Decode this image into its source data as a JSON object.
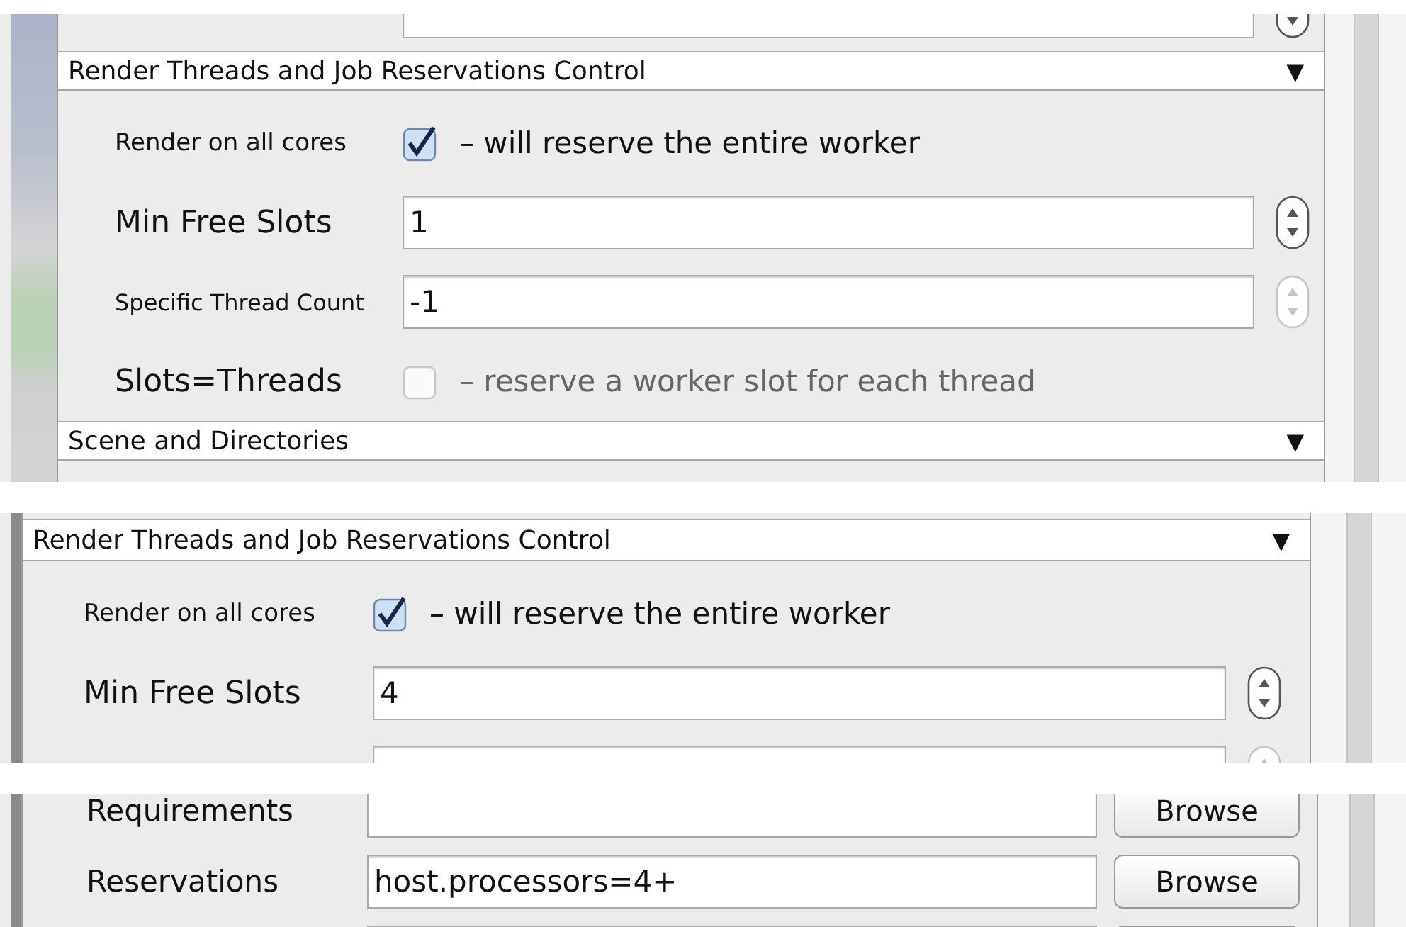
{
  "panels": [
    {
      "items": [
        {
          "kind": "spinner",
          "disabled": false
        },
        {
          "kind": "header",
          "title": "Render Threads and Job Reservations Control",
          "toggle": "▼"
        },
        {
          "kind": "checkbox",
          "label": "Render on all cores",
          "checked": true,
          "disabled": false,
          "note": "– will reserve the entire worker"
        },
        {
          "kind": "spinner",
          "label": "Min Free Slots",
          "value": "1",
          "disabled": false
        },
        {
          "kind": "spinner",
          "label": "Specific Thread Count",
          "value": "-1",
          "disabled": true
        },
        {
          "kind": "checkbox",
          "label": "Slots=Threads",
          "checked": false,
          "disabled": true,
          "note": "– reserve a worker slot for each thread"
        },
        {
          "kind": "header",
          "title": "Scene and Directories",
          "toggle": "▼"
        }
      ]
    },
    {
      "items": [
        {
          "kind": "header",
          "title": "Render Threads and Job Reservations Control",
          "toggle": "▼"
        },
        {
          "kind": "checkbox",
          "label": "Render on all cores",
          "checked": true,
          "disabled": false,
          "note": "– will reserve the entire worker"
        },
        {
          "kind": "spinner",
          "label": "Min Free Slots",
          "value": "4",
          "disabled": false
        },
        {
          "kind": "spinner",
          "disabled": true
        }
      ]
    },
    {
      "items": [
        {
          "kind": "field",
          "label": "Requirements",
          "button": "Browse"
        },
        {
          "kind": "field",
          "label": "Reservations",
          "value": "host.processors=4+",
          "button": "Browse"
        },
        {
          "kind": "field"
        }
      ]
    }
  ]
}
